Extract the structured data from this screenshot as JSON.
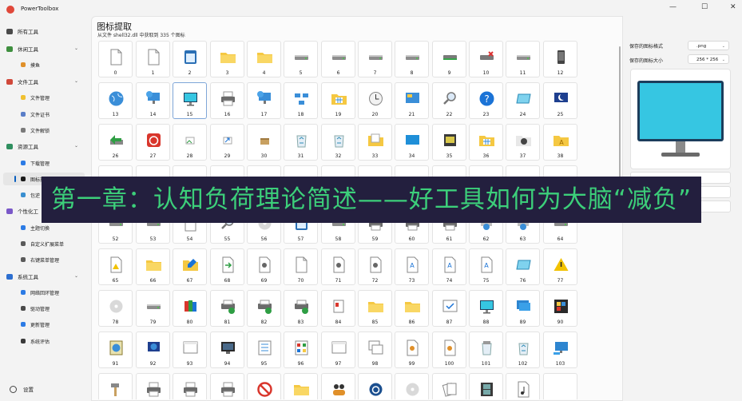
{
  "app": {
    "title": "PowerToolbox",
    "min": "—",
    "max": "☐",
    "close": "✕"
  },
  "sidebar": {
    "items": [
      {
        "label": "所有工具",
        "kind": "top",
        "icon": "home-icon",
        "color": "#4a4a4a"
      },
      {
        "label": "休闲工具",
        "kind": "group",
        "icon": "game-icon",
        "color": "#3f8f3f",
        "chev": "⌄"
      },
      {
        "label": "摸鱼",
        "kind": "sub",
        "icon": "fish-icon",
        "color": "#e0902a"
      },
      {
        "label": "文件工具",
        "kind": "group",
        "icon": "folder-icon",
        "color": "#d0483a",
        "chev": "⌄"
      },
      {
        "label": "文件管理",
        "kind": "sub",
        "icon": "file-icon",
        "color": "#f0c030"
      },
      {
        "label": "文件证书",
        "kind": "sub",
        "icon": "certificate-icon",
        "color": "#5a7ec8"
      },
      {
        "label": "文件解锁",
        "kind": "sub",
        "icon": "unlock-icon",
        "color": "#7a7a7a"
      },
      {
        "label": "资源工具",
        "kind": "group",
        "icon": "resource-icon",
        "color": "#2f8f5f",
        "chev": "⌄"
      },
      {
        "label": "下载管理",
        "kind": "sub",
        "icon": "download-icon",
        "color": "#2c7be5"
      },
      {
        "label": "图标提取",
        "kind": "sub",
        "icon": "icon-extract-icon",
        "color": "#1a1a1a",
        "active": true
      },
      {
        "label": "包逆",
        "kind": "sub",
        "icon": "package-icon",
        "color": "#3a8fd0"
      },
      {
        "label": "个性化工",
        "kind": "group",
        "icon": "personalize-icon",
        "color": "#7a58c8"
      },
      {
        "label": "主题切换",
        "kind": "sub",
        "icon": "theme-icon",
        "color": "#2c7be5"
      },
      {
        "label": "自定义扩展菜单",
        "kind": "sub",
        "icon": "menu-ext-icon",
        "color": "#5a5a5a"
      },
      {
        "label": "右键菜单管理",
        "kind": "sub",
        "icon": "context-menu-icon",
        "color": "#5a5a5a"
      },
      {
        "label": "系统工具",
        "kind": "group",
        "icon": "system-icon",
        "color": "#2c6fd0",
        "chev": "⌄"
      },
      {
        "label": "网络回环管理",
        "kind": "sub",
        "icon": "network-icon",
        "color": "#2c7be5"
      },
      {
        "label": "驱动管理",
        "kind": "sub",
        "icon": "driver-icon",
        "color": "#4a4a4a"
      },
      {
        "label": "更新管理",
        "kind": "sub",
        "icon": "update-icon",
        "color": "#2c7be5"
      },
      {
        "label": "系统评估",
        "kind": "sub",
        "icon": "assessment-icon",
        "color": "#3a3a3a"
      }
    ],
    "settings": "设置"
  },
  "main": {
    "title": "图标提取",
    "subtitle": "从文件 shell32.dll 中获取到 335 个图标",
    "selected_index": 15,
    "icons": [
      "doc",
      "doc",
      "app",
      "folder",
      "folder",
      "drive",
      "drive",
      "drive",
      "drive",
      "drive-green",
      "drive-x",
      "drive",
      "phone",
      "globe",
      "net-pc",
      "monitor",
      "printer",
      "net-pc",
      "network",
      "grid-folder",
      "clock",
      "desktop",
      "search",
      "help",
      "screen",
      "moon",
      "back",
      "power",
      "image",
      "shortcut",
      "box",
      "recycle",
      "recycle",
      "folder-doc",
      "blue-screen",
      "tools",
      "grid-folder",
      "gear-folder",
      "font-folder",
      "x",
      "x",
      "x",
      "x",
      "x",
      "x",
      "x",
      "x",
      "x",
      "x",
      "x",
      "x",
      "x",
      "drive",
      "drive",
      "doc",
      "search",
      "cd",
      "app",
      "drive",
      "printer",
      "printer",
      "printer",
      "net-globe",
      "net-globe",
      "drive",
      "warn-doc",
      "folder",
      "folder-pen",
      "green-arrow",
      "gear-doc",
      "doc",
      "gear-doc",
      "gear-doc",
      "font-doc",
      "font-doc",
      "font-doc",
      "screen",
      "warn",
      "cd",
      "drive",
      "books",
      "printer-ok",
      "printer-ok",
      "printer-ok",
      "doc-cards",
      "folder",
      "folder",
      "check-window",
      "monitor",
      "monitor2",
      "apps",
      "globe-doc",
      "globe-blue",
      "window",
      "monitor-dark",
      "grid-doc",
      "grid-colors",
      "window",
      "windows",
      "doc-key",
      "doc-key",
      "recycle-full",
      "recycle",
      "monitor-net",
      "hammer",
      "printer",
      "printer",
      "printer",
      "no",
      "folder",
      "people",
      "power-blue",
      "cd",
      "cards",
      "film",
      "music",
      "x"
    ]
  },
  "right_panel": {
    "format_label": "保存的图标格式",
    "format_value": ".png",
    "size_label": "保存的图标大小",
    "size_value": "256 * 256",
    "arrow": "⌄"
  },
  "banner": {
    "text": "第一章：认知负荷理论简述——好工具如何为大脑“减负”"
  },
  "colors": {
    "accent": "#0a5fbf",
    "banner_bg": "#231f3e",
    "banner_text": "#3ccf7a"
  }
}
